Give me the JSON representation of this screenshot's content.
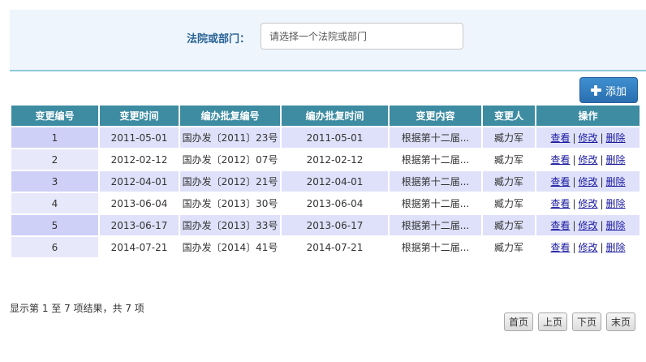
{
  "filter": {
    "label": "法院或部门：",
    "placeholder": "请选择一个法院或部门"
  },
  "toolbar": {
    "add_label": "添加",
    "add_icon": "plus-icon"
  },
  "table": {
    "columns": [
      "变更编号",
      "变更时间",
      "编办批复编号",
      "编办批复时间",
      "变更内容",
      "变更人",
      "操作"
    ],
    "rows": [
      {
        "num": "1",
        "change_date": "2011-05-01",
        "doc_no": "国办发〔2011〕23号",
        "approve_date": "2011-05-01",
        "content": "根据第十二届...",
        "person": "臧力军"
      },
      {
        "num": "2",
        "change_date": "2012-02-12",
        "doc_no": "国办发〔2012〕07号",
        "approve_date": "2012-02-12",
        "content": "根据第十二届...",
        "person": "臧力军"
      },
      {
        "num": "3",
        "change_date": "2012-04-01",
        "doc_no": "国办发〔2012〕21号",
        "approve_date": "2012-04-01",
        "content": "根据第十二届...",
        "person": "臧力军"
      },
      {
        "num": "4",
        "change_date": "2013-06-04",
        "doc_no": "国办发〔2013〕30号",
        "approve_date": "2013-06-04",
        "content": "根据第十二届...",
        "person": "臧力军"
      },
      {
        "num": "5",
        "change_date": "2013-06-17",
        "doc_no": "国办发〔2013〕33号",
        "approve_date": "2013-06-17",
        "content": "根据第十二届...",
        "person": "臧力军"
      },
      {
        "num": "6",
        "change_date": "2014-07-21",
        "doc_no": "国办发〔2014〕41号",
        "approve_date": "2014-07-21",
        "content": "根据第十二届...",
        "person": "臧力军"
      }
    ],
    "actions": {
      "view": "查看",
      "edit": "修改",
      "delete": "删除",
      "separator": "|"
    }
  },
  "summary": "显示第 1 至 7 项结果，共 7 项",
  "pager": {
    "first": "首页",
    "prev": "上页",
    "next": "下页",
    "last": "末页"
  }
}
